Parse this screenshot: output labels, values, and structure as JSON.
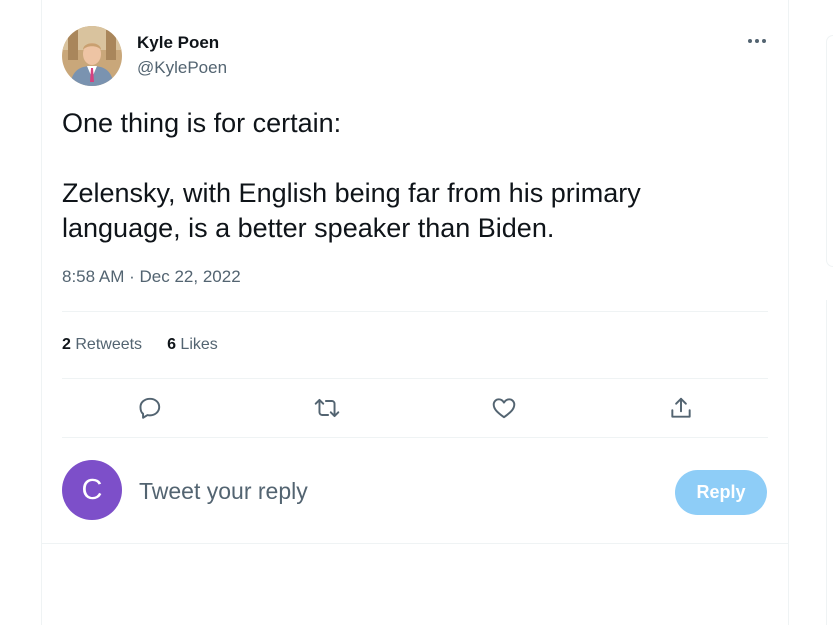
{
  "author": {
    "name": "Kyle Poen",
    "handle": "@KylePoen",
    "avatar_icon": "profile-photo"
  },
  "tweet": {
    "paragraphs": [
      "One thing is for certain:",
      "Zelensky, with English being far from his primary language, is a better speaker than Biden."
    ],
    "time": "8:58 AM",
    "separator": "·",
    "date": "Dec 22, 2022"
  },
  "stats": {
    "retweets_count": "2",
    "retweets_label": "Retweets",
    "likes_count": "6",
    "likes_label": "Likes"
  },
  "actions": {
    "icons": [
      "reply-icon",
      "retweet-icon",
      "like-icon",
      "share-icon"
    ]
  },
  "reply": {
    "avatar_letter": "C",
    "avatar_color": "#7d4fc9",
    "placeholder": "Tweet your reply",
    "button_label": "Reply",
    "button_color": "#8ecdf7"
  }
}
